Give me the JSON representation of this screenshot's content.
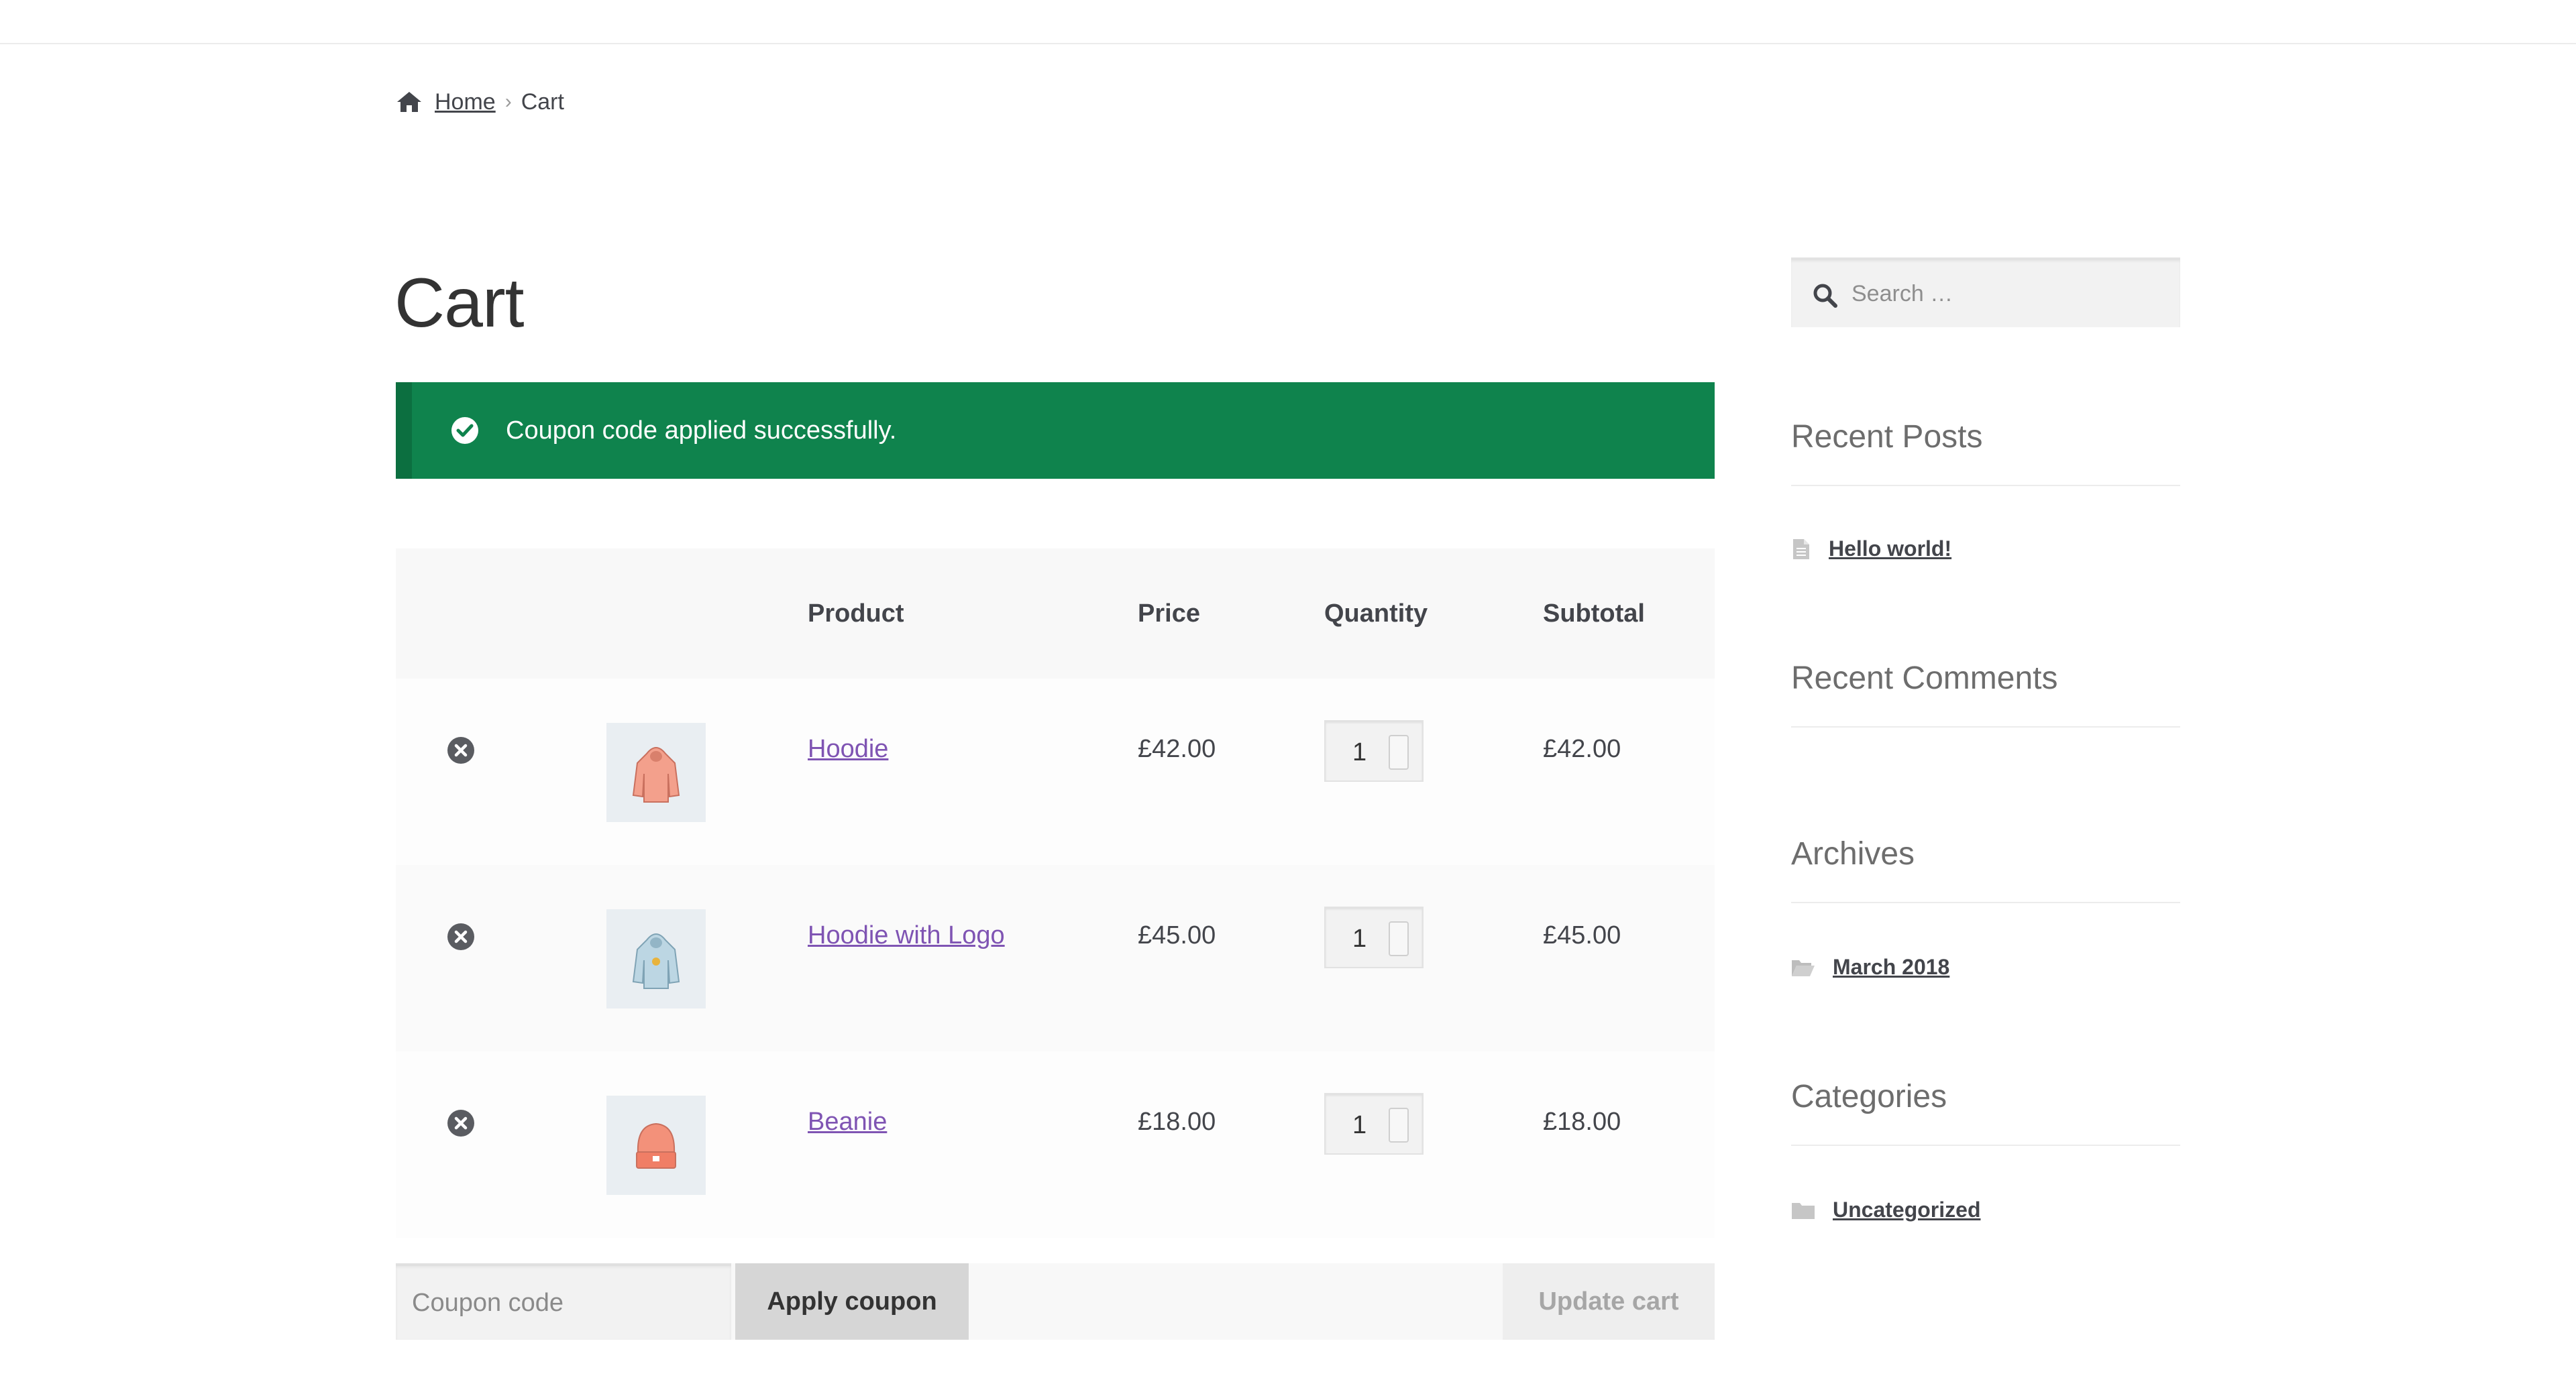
{
  "breadcrumb": {
    "home": "Home",
    "separator": "›",
    "current": "Cart"
  },
  "page": {
    "title": "Cart"
  },
  "notice": {
    "message": "Coupon code applied successfully.",
    "color": "#0f834d"
  },
  "table": {
    "headers": {
      "product": "Product",
      "price": "Price",
      "quantity": "Quantity",
      "subtotal": "Subtotal"
    },
    "rows": [
      {
        "name": "Hoodie",
        "price": "£42.00",
        "qty": "1",
        "subtotal": "£42.00",
        "thumb": "hoodie-thumbnail"
      },
      {
        "name": "Hoodie with Logo",
        "price": "£45.00",
        "qty": "1",
        "subtotal": "£45.00",
        "thumb": "hoodie-with-logo-thumbnail"
      },
      {
        "name": "Beanie",
        "price": "£18.00",
        "qty": "1",
        "subtotal": "£18.00",
        "thumb": "beanie-thumbnail"
      }
    ]
  },
  "actions": {
    "coupon_placeholder": "Coupon code",
    "apply_label": "Apply coupon",
    "update_label": "Update cart"
  },
  "sidebar": {
    "search_placeholder": "Search …",
    "recent_posts": {
      "title": "Recent Posts",
      "items": [
        "Hello world!"
      ]
    },
    "recent_comments": {
      "title": "Recent Comments"
    },
    "archives": {
      "title": "Archives",
      "items": [
        "March 2018"
      ]
    },
    "categories": {
      "title": "Categories",
      "items": [
        "Uncategorized"
      ]
    }
  },
  "colors": {
    "link_purple": "#7f54b3",
    "text": "#43454b"
  }
}
